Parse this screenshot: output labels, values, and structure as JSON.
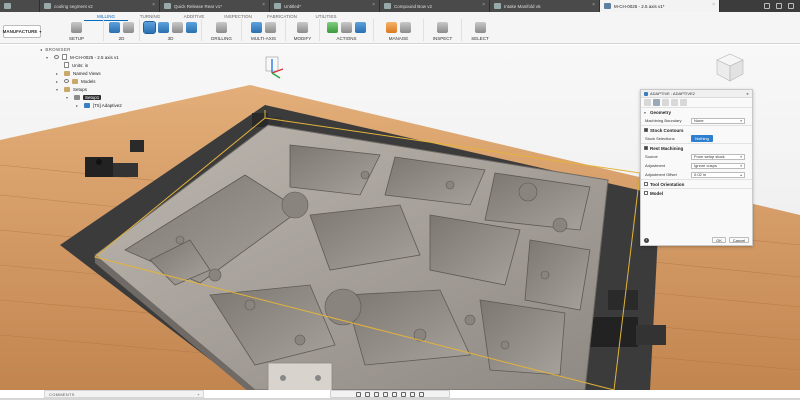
{
  "document_tabs": [
    {
      "label": "cooling segment v2",
      "active": false
    },
    {
      "label": "Quick Release Rear v1*",
      "active": false
    },
    {
      "label": "Untitled*",
      "active": false
    },
    {
      "label": "Compound Bow v2",
      "active": false
    },
    {
      "label": "Intake Manifold v5",
      "active": false
    },
    {
      "label": "M-CH-0025 - 2.5 axis v1*",
      "active": true
    }
  ],
  "toolbar": {
    "workspace": "MANUFACTURE",
    "subtabs": [
      {
        "label": "MILLING",
        "active": true
      },
      {
        "label": "TURNING",
        "active": false
      },
      {
        "label": "ADDITIVE",
        "active": false
      },
      {
        "label": "INSPECTION",
        "active": false
      },
      {
        "label": "FABRICATION",
        "active": false
      },
      {
        "label": "UTILITIES",
        "active": false
      }
    ],
    "groups": [
      {
        "label": "SETUP",
        "icons": [
          "setup-icon"
        ]
      },
      {
        "label": "2D",
        "icons": [
          "face-icon",
          "contour-icon"
        ]
      },
      {
        "label": "3D",
        "icons": [
          "adaptive-icon",
          "pocket-icon",
          "steep-shallow-icon",
          "scallop-icon"
        ]
      },
      {
        "label": "DRILLING",
        "icons": [
          "drill-icon"
        ]
      },
      {
        "label": "MULTI-AXIS",
        "icons": [
          "swarf-icon",
          "flow-icon"
        ]
      },
      {
        "label": "MODIFY",
        "icons": [
          "modify-icon"
        ]
      },
      {
        "label": "ACTIONS",
        "icons": [
          "simulate-icon",
          "post-icon",
          "nc-program-icon"
        ]
      },
      {
        "label": "MANAGE",
        "icons": [
          "tool-library-icon",
          "template-icon"
        ]
      },
      {
        "label": "INSPECT",
        "icons": [
          "measure-icon"
        ]
      },
      {
        "label": "SELECT",
        "icons": [
          "select-icon"
        ]
      }
    ]
  },
  "browser": {
    "title": "BROWSER",
    "items": [
      {
        "label": "M-CH-0025 - 2.5 axis v1",
        "level": 0,
        "kind": "doc"
      },
      {
        "label": "Units: in",
        "level": 1,
        "kind": "doc"
      },
      {
        "label": "Named Views",
        "level": 1,
        "kind": "folder"
      },
      {
        "label": "Models",
        "level": 1,
        "kind": "folder"
      },
      {
        "label": "Setups",
        "level": 1,
        "kind": "folder"
      },
      {
        "label": "Setup1",
        "level": 2,
        "kind": "setup"
      },
      {
        "label": "[T5] Adaptive2",
        "level": 3,
        "kind": "op"
      }
    ]
  },
  "dialog": {
    "title": "ADAPTIVE : ADAPTIVE2",
    "geometry": {
      "title": "Geometry",
      "machining_boundary_label": "Machining Boundary",
      "machining_boundary_value": "None"
    },
    "stock_contours": {
      "title": "Stock Contours",
      "stock_selections_label": "Stock Selections",
      "stock_selections_value": "Nothing"
    },
    "rest_machining": {
      "title": "Rest Machining",
      "source_label": "Source",
      "source_value": "From setup stock",
      "adjustment_label": "Adjustment",
      "adjustment_value": "Ignore cusps",
      "adjustment_offset_label": "Adjustment Offset",
      "adjustment_offset_value": "0.02 in"
    },
    "tool_orientation": {
      "title": "Tool Orientation"
    },
    "model": {
      "title": "Model"
    },
    "ok_label": "OK",
    "cancel_label": "Cancel"
  },
  "bottom": {
    "comments": "COMMENTS"
  },
  "colors": {
    "accent": "#0a6bbd",
    "stock_outline": "#e3b43a",
    "part_fill": "#a9a39c",
    "wood": "#d39a66"
  }
}
